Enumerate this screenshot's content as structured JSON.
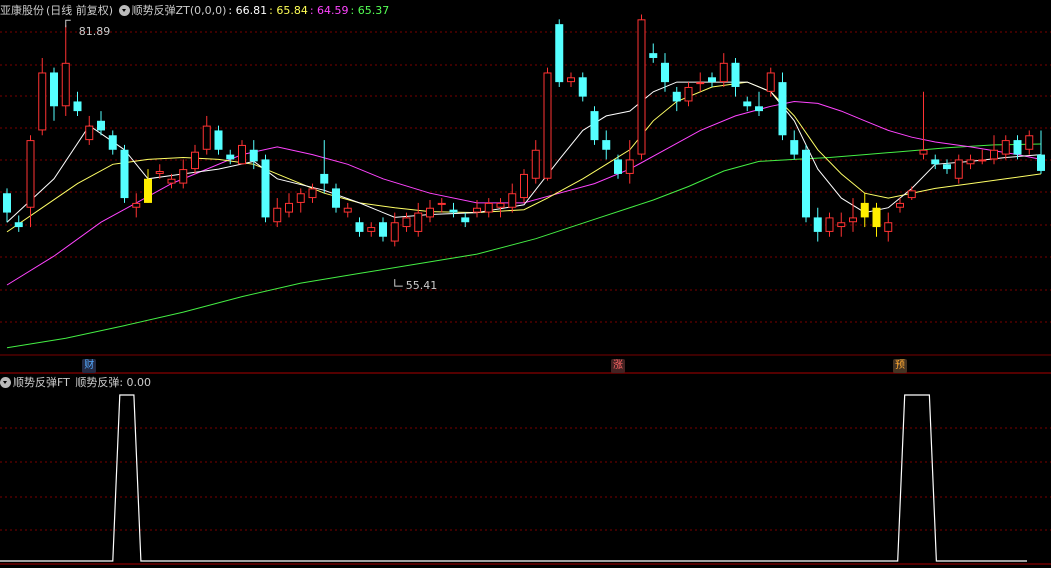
{
  "header": {
    "stock_name": "亚康股份",
    "period": "(日线 前复权)",
    "indicator": "顺势反弹ZT(0,0,0)",
    "values": [
      {
        "text": ": 66.81",
        "color": "#ffffff"
      },
      {
        "text": ": 65.84",
        "color": "#ffff55"
      },
      {
        "text": ": 64.59",
        "color": "#ff44ff"
      },
      {
        "text": ": 65.37",
        "color": "#55ff55"
      }
    ]
  },
  "sub_header": {
    "indicator": "顺势反弹FT",
    "series_label": "顺势反弹: 0.00"
  },
  "badges": [
    {
      "text": "财",
      "color": "#55aaff",
      "bg": "#222a44",
      "candle": 7
    },
    {
      "text": "涨",
      "color": "#ff6666",
      "bg": "#442222",
      "candle": 52
    },
    {
      "text": "预",
      "color": "#ffaa33",
      "bg": "#443322",
      "candle": 76
    }
  ],
  "annotations": {
    "high": "81.89",
    "low": "55.41"
  },
  "colors": {
    "up": "#ff3333",
    "down": "#55ffff",
    "signal": "#ffee00",
    "ma_fast": "#ffffff",
    "ma_mid": "#ffff66",
    "ma_slow": "#ff44ff",
    "ma_long": "#44ee44",
    "grid": "#7a0000"
  },
  "chart_data": [
    {
      "type": "candlestick",
      "ylim": [
        46,
        84.5
      ],
      "high_mark": {
        "candle": 5,
        "value": 81.89
      },
      "low_mark": {
        "candle": 33,
        "value": 55.41
      },
      "signal_candles": [
        12,
        73,
        74
      ],
      "candles": [
        [
          64.5,
          62.5,
          65.0,
          61.5
        ],
        [
          61.5,
          61.0,
          62.2,
          60.5
        ],
        [
          63.0,
          70.0,
          70.5,
          61.0
        ],
        [
          71.0,
          77.0,
          78.5,
          70.5
        ],
        [
          77.0,
          73.5,
          77.5,
          72.0
        ],
        [
          73.5,
          78.0,
          81.89,
          72.5
        ],
        [
          74.0,
          73.0,
          75.0,
          72.5
        ],
        [
          70.0,
          71.5,
          72.5,
          69.5
        ],
        [
          72.0,
          71.0,
          73.0,
          70.5
        ],
        [
          70.5,
          69.0,
          71.0,
          68.5
        ],
        [
          69.0,
          64.0,
          69.5,
          63.5
        ],
        [
          63.0,
          63.5,
          64.5,
          62.0
        ],
        [
          63.5,
          66.0,
          67.0,
          63.5
        ],
        [
          66.5,
          66.8,
          67.5,
          66.0
        ],
        [
          65.5,
          66.0,
          66.5,
          65.0
        ],
        [
          65.5,
          67.0,
          68.0,
          65.0
        ],
        [
          67.0,
          68.8,
          69.5,
          66.5
        ],
        [
          69.0,
          71.5,
          72.5,
          68.5
        ],
        [
          71.0,
          69.0,
          71.5,
          68.5
        ],
        [
          68.5,
          68.0,
          69.0,
          67.5
        ],
        [
          67.5,
          69.5,
          70.0,
          67.5
        ],
        [
          69.0,
          67.8,
          70.0,
          67.0
        ],
        [
          68.0,
          62.0,
          68.5,
          61.5
        ],
        [
          61.5,
          63.0,
          64.0,
          61.0
        ],
        [
          62.5,
          63.5,
          64.5,
          62.0
        ],
        [
          63.5,
          64.5,
          65.0,
          62.5
        ],
        [
          64.0,
          65.0,
          65.5,
          63.5
        ],
        [
          66.5,
          65.5,
          70.0,
          64.5
        ],
        [
          65.0,
          63.0,
          65.5,
          62.5
        ],
        [
          62.5,
          63.0,
          63.5,
          62.0
        ],
        [
          61.5,
          60.5,
          62.0,
          60.0
        ],
        [
          60.5,
          61.0,
          61.5,
          60.0
        ],
        [
          61.5,
          60.0,
          62.0,
          59.5
        ],
        [
          59.5,
          61.5,
          62.5,
          59.0
        ],
        [
          61.0,
          62.0,
          62.5,
          60.5
        ],
        [
          60.5,
          62.5,
          63.5,
          60.0
        ],
        [
          62.0,
          63.0,
          63.8,
          61.5
        ],
        [
          63.5,
          63.5,
          64.0,
          62.5
        ],
        [
          62.8,
          62.5,
          63.5,
          62.0
        ],
        [
          62.0,
          61.5,
          62.5,
          61.0
        ],
        [
          62.5,
          63.0,
          63.8,
          62.0
        ],
        [
          62.5,
          63.5,
          64.0,
          62.0
        ],
        [
          63.0,
          63.5,
          64.0,
          62.0
        ],
        [
          63.0,
          64.5,
          65.5,
          62.5
        ],
        [
          64.0,
          66.5,
          67.0,
          63.5
        ],
        [
          66.0,
          69.0,
          70.0,
          65.5
        ],
        [
          66.0,
          77.0,
          77.5,
          65.8
        ],
        [
          82.0,
          76.0,
          82.5,
          75.5
        ],
        [
          76.0,
          76.5,
          77.0,
          75.5
        ],
        [
          76.5,
          74.5,
          77.0,
          74.0
        ],
        [
          73.0,
          70.0,
          73.5,
          69.5
        ],
        [
          70.0,
          69.0,
          71.0,
          68.0
        ],
        [
          68.0,
          66.5,
          68.5,
          66.0
        ],
        [
          66.5,
          68.0,
          70.0,
          65.5
        ],
        [
          68.5,
          82.5,
          83.0,
          68.0
        ],
        [
          79.0,
          78.5,
          80.0,
          78.0
        ],
        [
          78.0,
          76.0,
          79.0,
          75.0
        ],
        [
          75.0,
          74.0,
          75.5,
          73.0
        ],
        [
          74.0,
          75.5,
          76.0,
          73.5
        ],
        [
          76.0,
          76.0,
          77.0,
          75.0
        ],
        [
          76.5,
          76.0,
          77.0,
          75.5
        ],
        [
          76.0,
          78.0,
          79.0,
          75.5
        ],
        [
          78.0,
          75.5,
          78.5,
          74.5
        ],
        [
          74.0,
          73.5,
          74.5,
          73.0
        ],
        [
          73.5,
          73.0,
          75.0,
          72.5
        ],
        [
          75.0,
          77.0,
          77.5,
          74.5
        ],
        [
          76.0,
          70.5,
          77.0,
          70.0
        ],
        [
          70.0,
          68.5,
          71.0,
          68.0
        ],
        [
          69.0,
          62.0,
          69.5,
          61.5
        ],
        [
          62.0,
          60.5,
          63.0,
          59.5
        ],
        [
          60.5,
          62.0,
          62.5,
          60.0
        ],
        [
          61.0,
          61.5,
          62.5,
          60.0
        ],
        [
          61.5,
          62.0,
          64.0,
          60.5
        ],
        [
          62.0,
          63.5,
          64.5,
          61.0
        ],
        [
          63.0,
          61.0,
          63.5,
          60.0
        ],
        [
          60.5,
          61.5,
          62.5,
          59.5
        ],
        [
          63.0,
          63.5,
          64.0,
          62.5
        ],
        [
          64.0,
          64.8,
          65.2,
          63.8
        ],
        [
          68.5,
          69.0,
          75.0,
          68.0
        ],
        [
          68.0,
          67.5,
          68.5,
          67.0
        ],
        [
          67.5,
          67.0,
          68.0,
          66.5
        ],
        [
          66.0,
          68.0,
          68.5,
          65.5
        ],
        [
          67.5,
          68.0,
          68.5,
          67.0
        ],
        [
          68.0,
          68.0,
          69.0,
          67.5
        ],
        [
          68.0,
          69.0,
          70.5,
          67.5
        ],
        [
          68.5,
          70.0,
          70.5,
          68.0
        ],
        [
          70.0,
          68.5,
          70.5,
          68.0
        ],
        [
          69.0,
          70.5,
          71.0,
          68.5
        ],
        [
          68.5,
          66.81,
          71.0,
          66.5
        ]
      ],
      "ma_fast": [
        [
          0,
          61.5
        ],
        [
          4,
          66
        ],
        [
          7,
          71.5
        ],
        [
          10,
          69
        ],
        [
          12,
          66
        ],
        [
          15,
          66.5
        ],
        [
          18,
          67
        ],
        [
          21,
          67.8
        ],
        [
          23,
          66
        ],
        [
          27,
          64.8
        ],
        [
          30,
          63.5
        ],
        [
          33,
          62
        ],
        [
          36,
          62.3
        ],
        [
          40,
          62.5
        ],
        [
          44,
          63.3
        ],
        [
          47,
          68
        ],
        [
          49,
          71
        ],
        [
          51,
          72.5
        ],
        [
          53,
          73
        ],
        [
          55,
          75
        ],
        [
          57,
          76
        ],
        [
          60,
          76
        ],
        [
          63,
          76
        ],
        [
          65,
          75
        ],
        [
          67,
          72
        ],
        [
          69,
          67
        ],
        [
          71,
          64
        ],
        [
          73,
          62.5
        ],
        [
          75,
          63
        ],
        [
          77,
          65
        ],
        [
          79,
          67.5
        ],
        [
          82,
          67.8
        ],
        [
          85,
          68.2
        ],
        [
          88,
          68.5
        ]
      ],
      "ma_mid": [
        [
          0,
          60.5
        ],
        [
          3,
          63
        ],
        [
          6,
          65.5
        ],
        [
          9,
          67.5
        ],
        [
          12,
          68
        ],
        [
          15,
          68.2
        ],
        [
          18,
          68
        ],
        [
          21,
          67.5
        ],
        [
          24,
          66
        ],
        [
          27,
          64.5
        ],
        [
          30,
          63.5
        ],
        [
          33,
          63
        ],
        [
          36,
          62.6
        ],
        [
          40,
          62.5
        ],
        [
          44,
          62.8
        ],
        [
          46,
          64
        ],
        [
          49,
          66
        ],
        [
          51,
          67.5
        ],
        [
          53,
          69
        ],
        [
          55,
          72
        ],
        [
          57,
          74
        ],
        [
          60,
          75.5
        ],
        [
          63,
          76
        ],
        [
          65,
          75
        ],
        [
          67,
          72.5
        ],
        [
          69,
          69
        ],
        [
          71,
          66.5
        ],
        [
          73,
          64.5
        ],
        [
          75,
          64
        ],
        [
          77,
          64.5
        ],
        [
          79,
          65
        ],
        [
          82,
          65.5
        ],
        [
          85,
          66
        ],
        [
          88,
          66.5
        ]
      ],
      "ma_slow": [
        [
          0,
          55
        ],
        [
          4,
          58
        ],
        [
          8,
          61.5
        ],
        [
          11,
          63.5
        ],
        [
          14,
          65.5
        ],
        [
          17,
          67
        ],
        [
          20,
          68.5
        ],
        [
          23,
          69.3
        ],
        [
          26,
          68.5
        ],
        [
          29,
          67.5
        ],
        [
          32,
          66
        ],
        [
          36,
          64.5
        ],
        [
          40,
          63.5
        ],
        [
          44,
          63.5
        ],
        [
          47,
          64.5
        ],
        [
          50,
          65.5
        ],
        [
          53,
          67
        ],
        [
          56,
          69
        ],
        [
          59,
          71
        ],
        [
          62,
          72.5
        ],
        [
          65,
          73.5
        ],
        [
          67,
          74
        ],
        [
          69,
          73.8
        ],
        [
          71,
          73
        ],
        [
          73,
          72
        ],
        [
          75,
          71
        ],
        [
          77,
          70.3
        ],
        [
          79,
          69.8
        ],
        [
          82,
          69.3
        ],
        [
          86,
          68.5
        ],
        [
          88,
          68
        ]
      ],
      "ma_long": [
        [
          0,
          48.5
        ],
        [
          5,
          49.5
        ],
        [
          10,
          50.8
        ],
        [
          15,
          52.2
        ],
        [
          20,
          53.8
        ],
        [
          25,
          55.2
        ],
        [
          30,
          56.2
        ],
        [
          35,
          57.2
        ],
        [
          40,
          58.2
        ],
        [
          45,
          59.8
        ],
        [
          50,
          61.8
        ],
        [
          55,
          63.8
        ],
        [
          58,
          65.2
        ],
        [
          61,
          66.8
        ],
        [
          64,
          67.8
        ],
        [
          67,
          68
        ],
        [
          70,
          68.2
        ],
        [
          73,
          68.5
        ],
        [
          76,
          68.8
        ],
        [
          80,
          69.2
        ],
        [
          84,
          69.5
        ],
        [
          88,
          69.6
        ]
      ]
    },
    {
      "type": "line",
      "title": "",
      "ylim": [
        0,
        1
      ],
      "pulses": [
        [
          9.6,
          10.8
        ],
        [
          76.4,
          78.5
        ]
      ]
    }
  ]
}
